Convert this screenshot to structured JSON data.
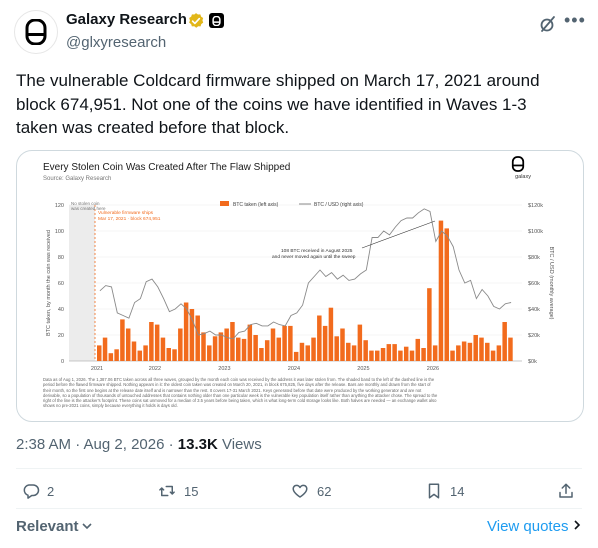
{
  "author": {
    "name": "Galaxy Research",
    "handle": "@glxyresearch"
  },
  "tweet": {
    "text": "The vulnerable Coldcard firmware shipped on March 17, 2021 around\nblock 674,951. Not one of the coins we have identified in Waves 1-3\ntaken was created before that block.",
    "timestamp": "2:38 AM · Aug 2, 2026 · ",
    "views_count": "13.3K",
    "views_label": " Views"
  },
  "media": {
    "chart_title": "Every Stolen Coin Was Created After The Flaw Shipped",
    "source": "Source: Galaxy Research",
    "brand": "galaxy",
    "note": "Data as of Aug 1, 2026. The 1,387.06 BTC taken across all three waves, grouped by the month each coin was received by the address it was later stolen from. The shaded band to the left of the dashed line is the period before the flawed firmware shipped. Nothing appears in it: the oldest coin taken was created on March 20, 2021, in block 675,825, five days after the release. Bars are monthly and drawn from the start of their month, so the first one begins at the release date itself and is narrower than the rest. It covers 17-31 March 2021. Keys generated before that date were produced by the working generator and are not derivable, so a population of thousands of untouched addresses that contains nothing older than one particular week is the vulnerable key population itself rather than anything the attacker chose. The spread to the right of the line is the attacker's footprint. These coins sat unmoved for a median of 3.5 years before being taken, which is what long-term cold storage looks like. Both halves are needed — an exchange wallet also shows no pre-2021 coins, simply because everything it holds is days old."
  },
  "chart_data": {
    "type": "bar",
    "title": "Every Stolen Coin Was Created After The Flaw Shipped",
    "subtitle": "Source: Galaxy Research",
    "ylabel": "BTC taken, by month the coin was received",
    "y2label": "BTC / USD (monthly average)",
    "ylim": [
      0,
      120
    ],
    "y2lim": [
      0,
      120000
    ],
    "yticks": [
      "0",
      "20",
      "40",
      "60",
      "80",
      "100",
      "120"
    ],
    "y2ticks": [
      "$0k",
      "$20k",
      "$40k",
      "$60k",
      "$80k",
      "$100k",
      "$120k"
    ],
    "xticks": [
      "2021",
      "2022",
      "2023",
      "2024",
      "2025",
      "2026"
    ],
    "legend": {
      "placement": "top-center",
      "bars": "BTC taken (left axis)",
      "line": "BTC / USD (right axis)"
    },
    "shaded_label": "No stolen coin was created here",
    "marker_label_1": "Vulnerable firmware ships",
    "marker_label_2": "Mar 17, 2021 · block 674,951",
    "annotation_1": "108 BTC received in August 2025",
    "annotation_2": "and never moved again until the sweep",
    "start_month": "2021-03",
    "series": [
      {
        "name": "BTC taken (left axis)",
        "values": [
          12,
          18,
          6,
          9,
          32,
          25,
          15,
          8,
          12,
          30,
          28,
          18,
          10,
          9,
          25,
          45,
          40,
          35,
          22,
          12,
          19,
          22,
          25,
          30,
          18,
          17,
          28,
          20,
          10,
          16,
          25,
          18,
          27,
          27,
          7,
          14,
          12,
          18,
          35,
          27,
          41,
          19,
          25,
          14,
          12,
          28,
          16,
          8,
          8,
          10,
          13,
          13,
          8,
          11,
          8,
          17,
          10,
          56,
          12,
          108,
          102,
          8,
          12,
          15,
          14,
          20,
          18,
          14,
          8,
          12,
          30,
          18
        ]
      },
      {
        "name": "BTC / USD (right axis)",
        "values": [
          54,
          58,
          57,
          37,
          35,
          33,
          45,
          48,
          61,
          63,
          57,
          48,
          38,
          40,
          44,
          40,
          31,
          20,
          21,
          23,
          20,
          20,
          18,
          17,
          22,
          23,
          28,
          29,
          27,
          27,
          30,
          28,
          27,
          35,
          37,
          43,
          60,
          65,
          70,
          65,
          68,
          63,
          66,
          62,
          63,
          67,
          70,
          95,
          95,
          100,
          97,
          103,
          108,
          110,
          110,
          114,
          117,
          115,
          92,
          100,
          96,
          88,
          70,
          60,
          62,
          48,
          55,
          50,
          42,
          40,
          44,
          45
        ]
      }
    ]
  },
  "actions": {
    "replies": "2",
    "reposts": "15",
    "likes": "62",
    "bookmarks": "14"
  },
  "footer": {
    "relevant": "Relevant",
    "view_quotes": "View quotes"
  }
}
